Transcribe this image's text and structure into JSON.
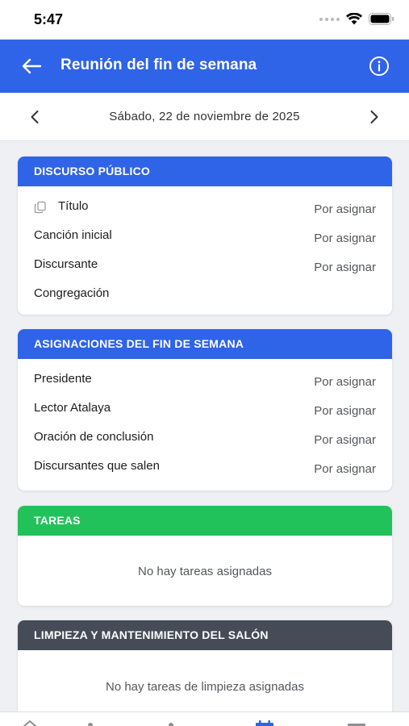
{
  "status_bar": {
    "time": "5:47"
  },
  "header": {
    "title": "Reunión del fin de semana"
  },
  "date_nav": {
    "date": "Sábado, 22 de noviembre de 2025"
  },
  "sections": {
    "public_talk": {
      "title": "DISCURSO PÚBLICO",
      "rows": [
        {
          "label": "Título",
          "value": "Por asignar"
        },
        {
          "label": "Canción inicial",
          "value": "Por asignar"
        },
        {
          "label": "Discursante",
          "value": "Por asignar"
        },
        {
          "label": "Congregación",
          "value": ""
        }
      ]
    },
    "weekend_assignments": {
      "title": "ASIGNACIONES DEL FIN DE SEMANA",
      "rows": [
        {
          "label": "Presidente",
          "value": "Por asignar"
        },
        {
          "label": "Lector Atalaya",
          "value": "Por asignar"
        },
        {
          "label": "Oración de conclusión",
          "value": "Por asignar"
        },
        {
          "label": "Discursantes que salen",
          "value": "Por asignar"
        }
      ]
    },
    "tasks": {
      "title": "TAREAS",
      "empty": "No hay tareas asignadas"
    },
    "cleaning": {
      "title": "LIMPIEZA Y MANTENIMIENTO DEL SALÓN",
      "empty": "No hay tareas de limpieza asignadas"
    }
  },
  "colors": {
    "primary": "#2f63e8",
    "tasks_header": "#22c25a",
    "cleaning_header": "#454b57",
    "background": "#eef0f3"
  }
}
